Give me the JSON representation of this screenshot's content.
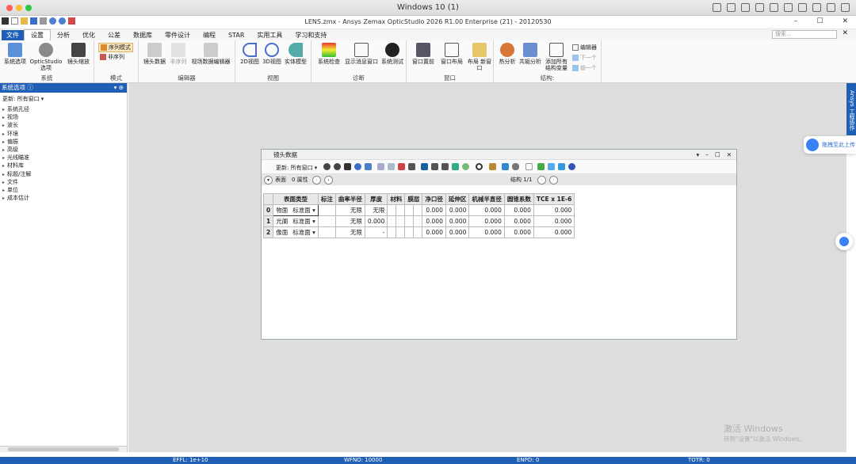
{
  "mac": {
    "title": "Windows 10 (1)"
  },
  "app": {
    "title": "LENS.zmx - Ansys Zemax OpticStudio 2026 R1.00   Enterprise (21) - 20120530",
    "win_min": "–",
    "win_max": "☐",
    "win_close": "✕"
  },
  "menu": {
    "items": [
      "文件",
      "设置",
      "分析",
      "优化",
      "公差",
      "数据库",
      "零件设计",
      "编程",
      "STAR",
      "实用工具",
      "学习和支持"
    ],
    "search_placeholder": "搜索...",
    "close": "✕"
  },
  "ribbon": {
    "system": {
      "label": "系统",
      "buttons": [
        "系统选项",
        "OpticStudio 选项",
        "镜头缩放"
      ]
    },
    "mode": {
      "label": "模式",
      "seq": "序列模式",
      "nonseq": "非序列"
    },
    "editors": {
      "label": "编辑器",
      "buttons": [
        "镜头数据",
        "非序列",
        "视场数据编辑器"
      ]
    },
    "view": {
      "label": "视图",
      "buttons": [
        "2D视图",
        "3D视图",
        "实体模型"
      ]
    },
    "diag": {
      "label": "诊断",
      "buttons": [
        "系统检查",
        "显示消息窗口",
        "系统测试"
      ]
    },
    "window": {
      "label": "窗口",
      "buttons": [
        "窗口置前",
        "窗口布局",
        "布局 新窗口"
      ]
    },
    "config": {
      "label": "结构:",
      "buttons": [
        "热分析",
        "共轭分析",
        "添加所有 结构变量"
      ],
      "small": [
        "编辑器",
        "下一个",
        "前一个"
      ]
    }
  },
  "sidebar": {
    "title": "系统选项",
    "update": "更新: 所有窗口 ▾",
    "items": [
      "系统孔径",
      "视场",
      "波长",
      "环境",
      "偏振",
      "高级",
      "光线瞄准",
      "材料库",
      "标题/注解",
      "文件",
      "单位",
      "成本估计"
    ]
  },
  "side_tab": "Ansys 工程协作",
  "float_tip": "拖拽至此上传",
  "watermark": {
    "line1": "激活 Windows",
    "line2": "转到\"设置\"以激活 Windows。"
  },
  "lde": {
    "title": "镜头数据",
    "update": "更新: 所有窗口 ▾",
    "surface": "表面",
    "props": "0 属性",
    "config": "结构 1/1",
    "headers": [
      "",
      "表面类型",
      "",
      "标注",
      "曲率半径",
      "厚度",
      "材料",
      "膜层",
      "净口径",
      "延伸区",
      "机械半直径",
      "圆锥系数",
      "TCE x 1E-6"
    ],
    "rows": [
      {
        "idx": "0",
        "name": "物面",
        "type": "标准面",
        "arrow": "▾",
        "radius": "无限",
        "thick": "无限",
        "clear": "0.000",
        "chip": "0.000",
        "mech": "0.000",
        "conic": "0.000",
        "tce": "0.000"
      },
      {
        "idx": "1",
        "name": "光阑",
        "type": "标准面",
        "arrow": "▾",
        "radius": "无限",
        "thick": "0.000",
        "clear": "0.000",
        "chip": "0.000",
        "mech": "0.000",
        "conic": "0.000",
        "tce": "0.000"
      },
      {
        "idx": "2",
        "name": "像面",
        "type": "标准面",
        "arrow": "▾",
        "radius": "无限",
        "thick": "-",
        "clear": "0.000",
        "chip": "0.000",
        "mech": "0.000",
        "conic": "0.000",
        "tce": "0.000"
      }
    ]
  },
  "status": {
    "effl": "EFFL: 1e+10",
    "wfno": "WFNO: 10000",
    "enpd": "ENPD: 0",
    "totr": "TOTR: 0"
  },
  "colors": {
    "accent": "#1f5fb5",
    "mac_red": "#fe5f57",
    "mac_yellow": "#febc2e",
    "mac_green": "#28c840",
    "seq_bg": "#fde9c3"
  }
}
